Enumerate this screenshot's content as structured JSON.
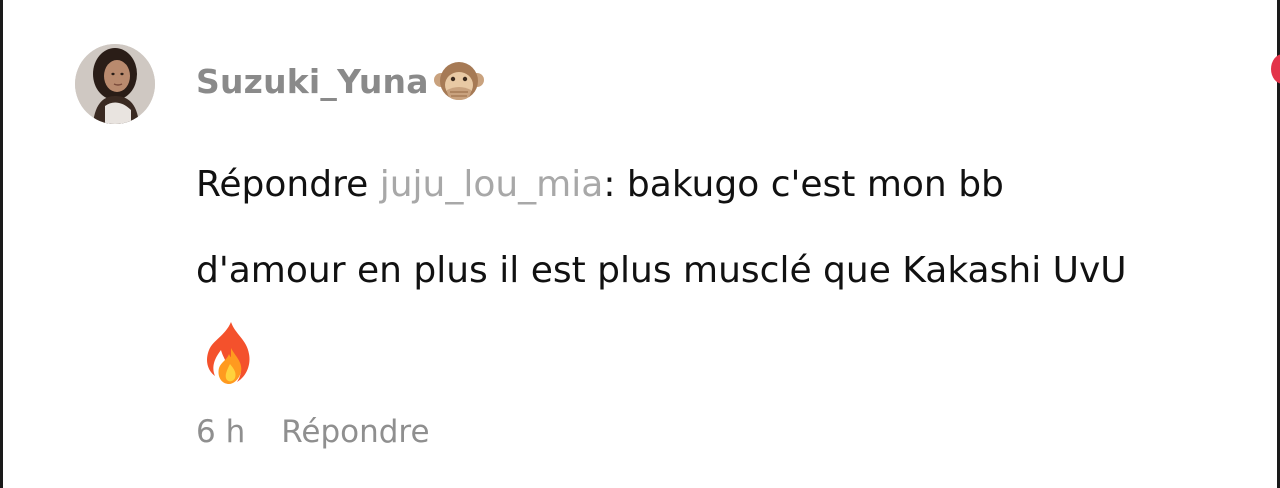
{
  "comment": {
    "author": "Suzuki_Yuna",
    "author_emoji": "speak-no-evil-monkey-icon",
    "reply_prefix": "Répondre",
    "mention": "juju_lou_mia",
    "text_line1": ": bakugo c'est mon bb",
    "text_line2": "d'amour en plus il est plus musclé que Kakashi UvU",
    "trailing_emoji": "fire-icon",
    "timestamp": "6 h",
    "reply_action": "Répondre"
  },
  "colors": {
    "username": "#8a8a8a",
    "mention": "#a8a8a8",
    "body_text": "#111111",
    "meta_text": "#8f8f8f",
    "notification_dot": "#e3344a"
  }
}
